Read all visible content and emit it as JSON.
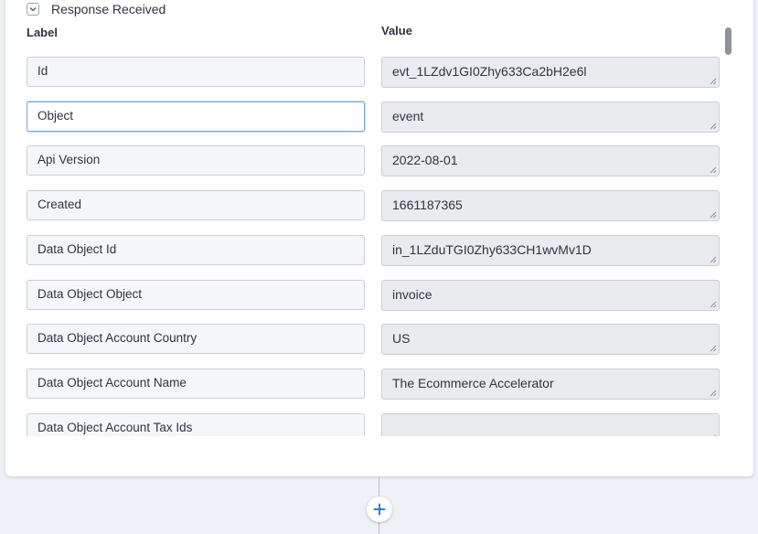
{
  "section": {
    "title": "Response Received",
    "toggle_icon": "chevron-down-icon"
  },
  "columns": {
    "label": "Label",
    "value": "Value"
  },
  "rows": [
    {
      "label": "Id",
      "value": "evt_1LZdv1GI0Zhy633Ca2bH2e6l"
    },
    {
      "label": "Object",
      "value": "event"
    },
    {
      "label": "Api Version",
      "value": "2022-08-01"
    },
    {
      "label": "Created",
      "value": "1661187365"
    },
    {
      "label": "Data Object Id",
      "value": "in_1LZduTGI0Zhy633CH1wvMv1D"
    },
    {
      "label": "Data Object Object",
      "value": "invoice"
    },
    {
      "label": "Data Object Account Country",
      "value": "US"
    },
    {
      "label": "Data Object Account Name",
      "value": "The Ecommerce Accelerator"
    },
    {
      "label": "Data Object Account Tax Ids",
      "value": ""
    }
  ],
  "add_step_icon": "plus-icon",
  "colors": {
    "accent": "#2d7dd2",
    "focus_border": "#7ea7d8",
    "value_bg": "#e9ebee",
    "label_bg": "#f4f6f9"
  }
}
